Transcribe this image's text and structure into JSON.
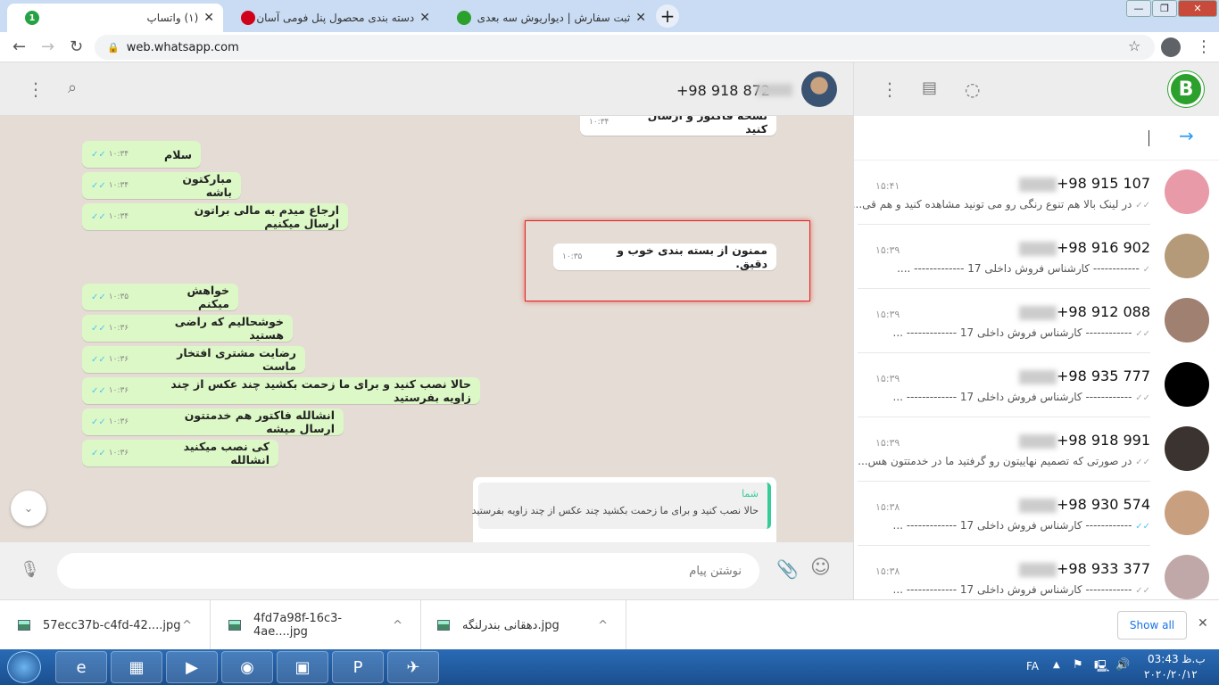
{
  "browser": {
    "tabs": [
      {
        "title": "(۱) واتساپ",
        "favicon": "whatsapp-badge",
        "badge": "1",
        "color": "#25a244"
      },
      {
        "title": "دسته بندی محصول پنل فومی آسان نصب -",
        "favicon": "brand-logo",
        "color": "#d0021b"
      },
      {
        "title": "ثبت سفارش | دیواریوش سه بعدی",
        "favicon": "b-logo",
        "color": "#2ca02c"
      }
    ],
    "url": "web.whatsapp.com"
  },
  "chat": {
    "contact": "+98 918 872",
    "messages": [
      {
        "dir": "out",
        "text": "نسخه فاکتور و ارسال کنید",
        "time": "۱۰:۳۴"
      },
      {
        "dir": "in",
        "text": "سلام",
        "time": "۱۰:۳۴"
      },
      {
        "dir": "in",
        "text": "مبارکتون باشه",
        "time": "۱۰:۳۴"
      },
      {
        "dir": "in",
        "text": "ارجاع میدم به مالی براتون ارسال میکنیم",
        "time": "۱۰:۳۴"
      },
      {
        "dir": "out",
        "text": "ممنون از بسته بندی خوب و دقیق.",
        "time": "۱۰:۳۵",
        "highlighted": true
      },
      {
        "dir": "in",
        "text": "خواهش میکنم",
        "time": "۱۰:۳۵"
      },
      {
        "dir": "in",
        "text": "خوشحالیم که راضی هستید",
        "time": "۱۰:۳۶"
      },
      {
        "dir": "in",
        "text": "رضایت مشتری افتخار ماست",
        "time": "۱۰:۳۶"
      },
      {
        "dir": "in",
        "text": "حالا نصب کنید و برای ما زحمت بکشید چند عکس از چند زاویه بفرستید",
        "time": "۱۰:۳۶"
      },
      {
        "dir": "in",
        "text": "انشالله فاکتور هم خدمتتون ارسال میشه",
        "time": "۱۰:۳۶"
      },
      {
        "dir": "in",
        "text": "کی نصب میکنید انشالله",
        "time": "۱۰:۳۶"
      }
    ],
    "quote": {
      "author": "شما",
      "text": "حالا نصب کنید و برای ما زحمت بکشید چند عکس از چند زاویه بفرستید"
    },
    "compose_placeholder": "نوشتن پیام",
    "highlight_color": "#e02020"
  },
  "sidebar": {
    "chats": [
      {
        "name": "+98 915 107",
        "time": "۱۵:۴۱",
        "preview": "در لینک بالا هم تنوع رنگی رو می تونید مشاهده کنید و هم قی...",
        "avatar": "#e89aa8",
        "ticks": "double-gray"
      },
      {
        "name": "+98 916 902",
        "time": "۱۵:۳۹",
        "preview": "------------ کارشناس فروش داخلی 17 ------------- ....",
        "avatar": "#b49a78",
        "ticks": "single-gray"
      },
      {
        "name": "+98 912 088",
        "time": "۱۵:۳۹",
        "preview": "------------ کارشناس فروش داخلی 17 ------------- ...",
        "avatar": "#a08070",
        "ticks": "double-gray"
      },
      {
        "name": "+98 935 777",
        "time": "۱۵:۳۹",
        "preview": "------------ کارشناس فروش داخلی 17 ------------- ...",
        "avatar": "#000000",
        "ticks": "double-gray"
      },
      {
        "name": "+98 918 991",
        "time": "۱۵:۳۹",
        "preview": "در صورتی که تصمیم نهاییتون رو گرفتید ما در خدمتتون هس...",
        "avatar": "#3a3330",
        "ticks": "double-gray"
      },
      {
        "name": "+98 930 574",
        "time": "۱۵:۳۸",
        "preview": "------------ کارشناس فروش داخلی 17 ------------- ...",
        "avatar": "#c8a080",
        "ticks": "double-blue"
      },
      {
        "name": "+98 933 377",
        "time": "۱۵:۳۸",
        "preview": "------------ کارشناس فروش داخلی 17 ------------- ...",
        "avatar": "#c0a8a8",
        "ticks": "double-gray"
      }
    ]
  },
  "downloads": {
    "items": [
      "57ecc37b-c4fd-42....jpg",
      "4fd7a98f-16c3-4ae....jpg",
      "دهقانی بندرلنگه.jpg"
    ],
    "show_all": "Show all"
  },
  "taskbar": {
    "lang": "FA",
    "time": "03:43 ب.ظ",
    "date": "۲۰۲۰/۲۰/۱۲",
    "apps": [
      "internet-explorer",
      "file-explorer",
      "media-player",
      "chrome",
      "app-window",
      "p-app",
      "telegram"
    ]
  }
}
